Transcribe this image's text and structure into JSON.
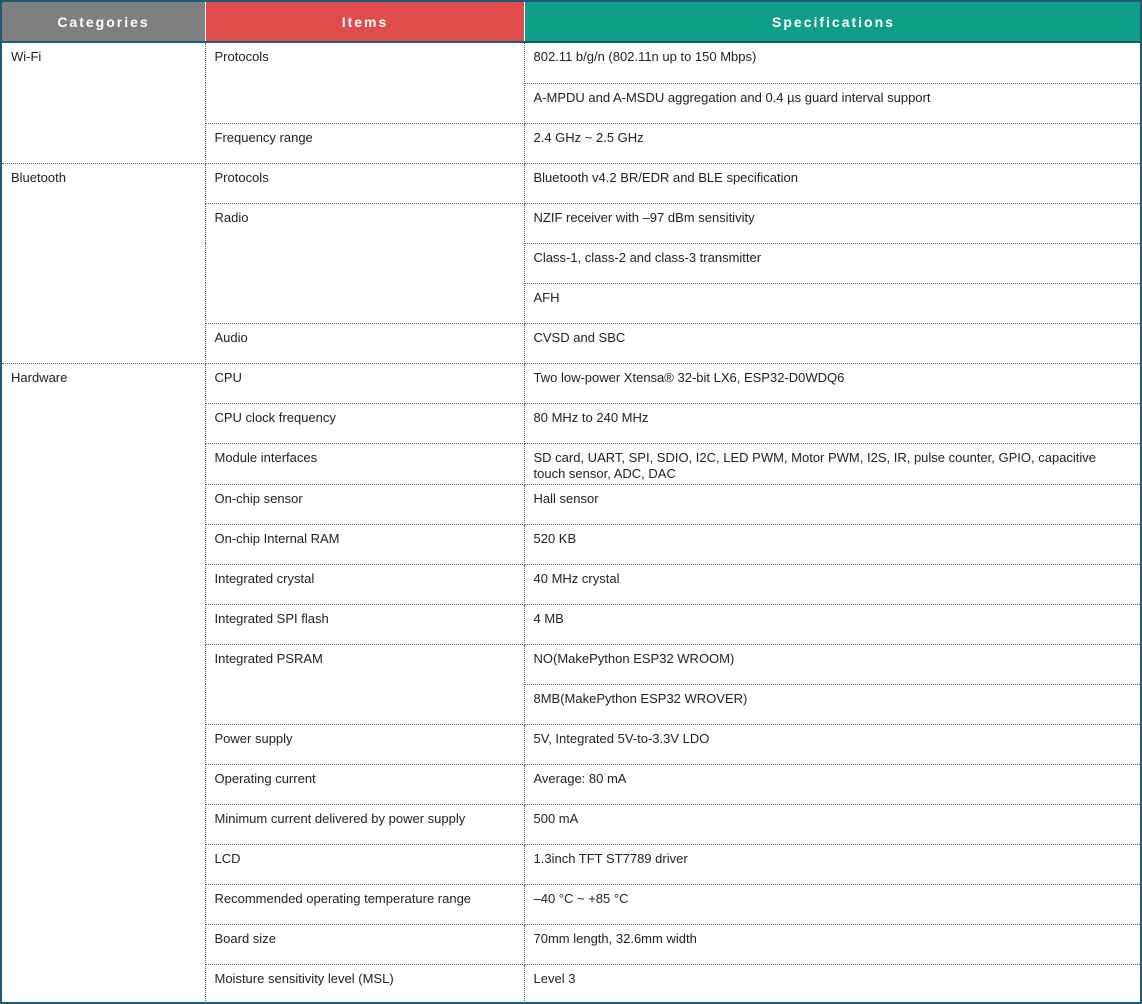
{
  "headers": {
    "categories": "Categories",
    "items": "Items",
    "specifications": "Specifications"
  },
  "colors": {
    "categories_header": "#7f7f7f",
    "items_header": "#e04b4b",
    "specifications_header": "#0f9e8a",
    "border": "#1f5a7a"
  },
  "groups": [
    {
      "category": "Wi-Fi",
      "items": [
        {
          "label": "Protocols",
          "specs": [
            "802.11 b/g/n (802.11n up to 150 Mbps)",
            "A-MPDU and A-MSDU aggregation and 0.4 µs guard interval support"
          ]
        },
        {
          "label": "Frequency range",
          "specs": [
            "2.4 GHz ~ 2.5 GHz"
          ]
        }
      ]
    },
    {
      "category": "Bluetooth",
      "items": [
        {
          "label": "Protocols",
          "specs": [
            "Bluetooth v4.2 BR/EDR and BLE specification"
          ]
        },
        {
          "label": "Radio",
          "specs": [
            "NZIF receiver with –97 dBm sensitivity",
            "Class-1, class-2 and class-3 transmitter",
            "AFH"
          ]
        },
        {
          "label": "Audio",
          "specs": [
            "CVSD and SBC"
          ]
        }
      ]
    },
    {
      "category": "Hardware",
      "items": [
        {
          "label": "CPU",
          "specs": [
            "Two low-power Xtensa® 32-bit LX6, ESP32-D0WDQ6"
          ]
        },
        {
          "label": "CPU clock frequency",
          "specs": [
            "80 MHz to 240 MHz"
          ]
        },
        {
          "label": "Module interfaces",
          "specs": [
            "SD card, UART, SPI, SDIO, I2C, LED PWM, Motor PWM, I2S, IR, pulse counter, GPIO, capacitive touch sensor, ADC, DAC"
          ]
        },
        {
          "label": "On-chip sensor",
          "specs": [
            "Hall sensor"
          ]
        },
        {
          "label": "On-chip Internal RAM",
          "specs": [
            "520 KB"
          ]
        },
        {
          "label": "Integrated crystal",
          "specs": [
            "40 MHz crystal"
          ]
        },
        {
          "label": "Integrated SPI flash",
          "specs": [
            "4 MB"
          ]
        },
        {
          "label": "Integrated PSRAM",
          "specs": [
            "NO(MakePython ESP32 WROOM)",
            "8MB(MakePython ESP32 WROVER)"
          ]
        },
        {
          "label": "Power supply",
          "specs": [
            "5V, Integrated 5V-to-3.3V LDO"
          ]
        },
        {
          "label": "Operating current",
          "specs": [
            "Average: 80 mA"
          ]
        },
        {
          "label": "Minimum current delivered by power supply",
          "specs": [
            "500 mA"
          ]
        },
        {
          "label": "LCD",
          "specs": [
            "1.3inch TFT ST7789 driver"
          ]
        },
        {
          "label": "Recommended operating temperature range",
          "specs": [
            "–40 °C ~ +85 °C"
          ]
        },
        {
          "label": "Board size",
          "specs": [
            "70mm length, 32.6mm width"
          ]
        },
        {
          "label": "Moisture sensitivity level (MSL)",
          "specs": [
            "Level 3"
          ]
        }
      ]
    }
  ]
}
